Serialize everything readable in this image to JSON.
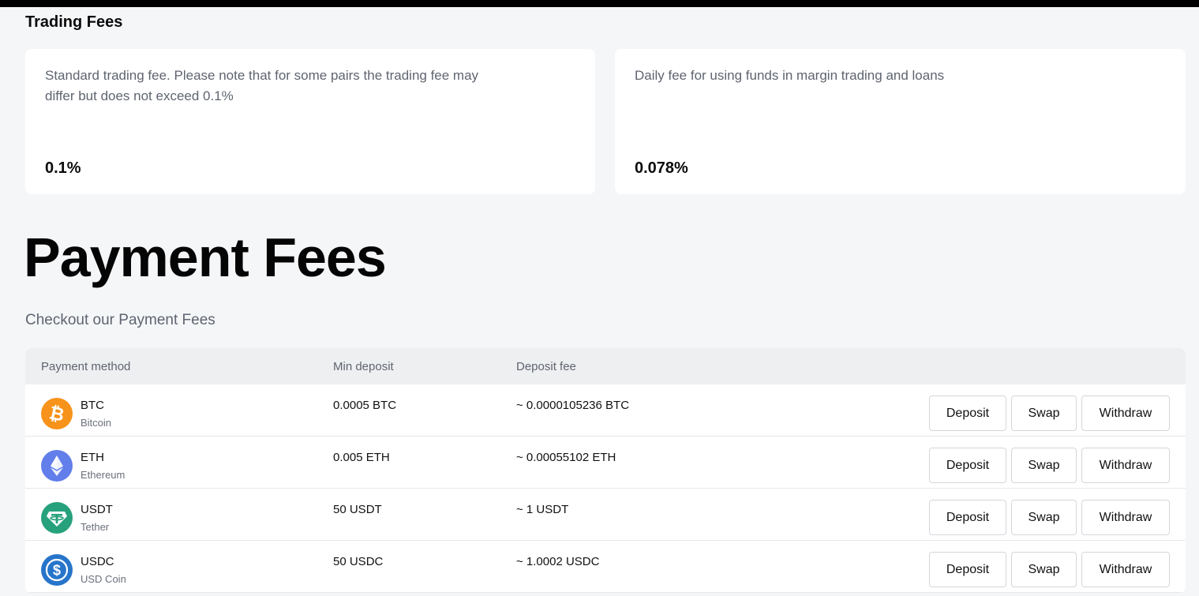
{
  "trading_fees": {
    "title": "Trading Fees",
    "cards": [
      {
        "description": "Standard trading fee. Please note that for some pairs the trading fee may differ but does not exceed 0.1%",
        "value": "0.1%"
      },
      {
        "description": "Daily fee for using funds in margin trading and loans",
        "value": "0.078%"
      }
    ]
  },
  "payment_fees": {
    "title": "Payment Fees",
    "subtitle": "Checkout our Payment Fees",
    "columns": [
      "Payment method",
      "Min deposit",
      "Deposit fee"
    ],
    "actions": {
      "deposit": "Deposit",
      "swap": "Swap",
      "withdraw": "Withdraw"
    },
    "rows": [
      {
        "symbol": "BTC",
        "name": "Bitcoin",
        "icon": "bitcoin-icon",
        "color": "#f7931a",
        "min_deposit": "0.0005 BTC",
        "deposit_fee": "~ 0.0000105236 BTC"
      },
      {
        "symbol": "ETH",
        "name": "Ethereum",
        "icon": "ethereum-icon",
        "color": "#627eea",
        "min_deposit": "0.005 ETH",
        "deposit_fee": "~ 0.00055102 ETH"
      },
      {
        "symbol": "USDT",
        "name": "Tether",
        "icon": "tether-icon",
        "color": "#26a17b",
        "min_deposit": "50 USDT",
        "deposit_fee": "~ 1 USDT"
      },
      {
        "symbol": "USDC",
        "name": "USD Coin",
        "icon": "usd-coin-icon",
        "color": "#2775ca",
        "min_deposit": "50 USDC",
        "deposit_fee": "~ 1.0002 USDC"
      }
    ]
  }
}
